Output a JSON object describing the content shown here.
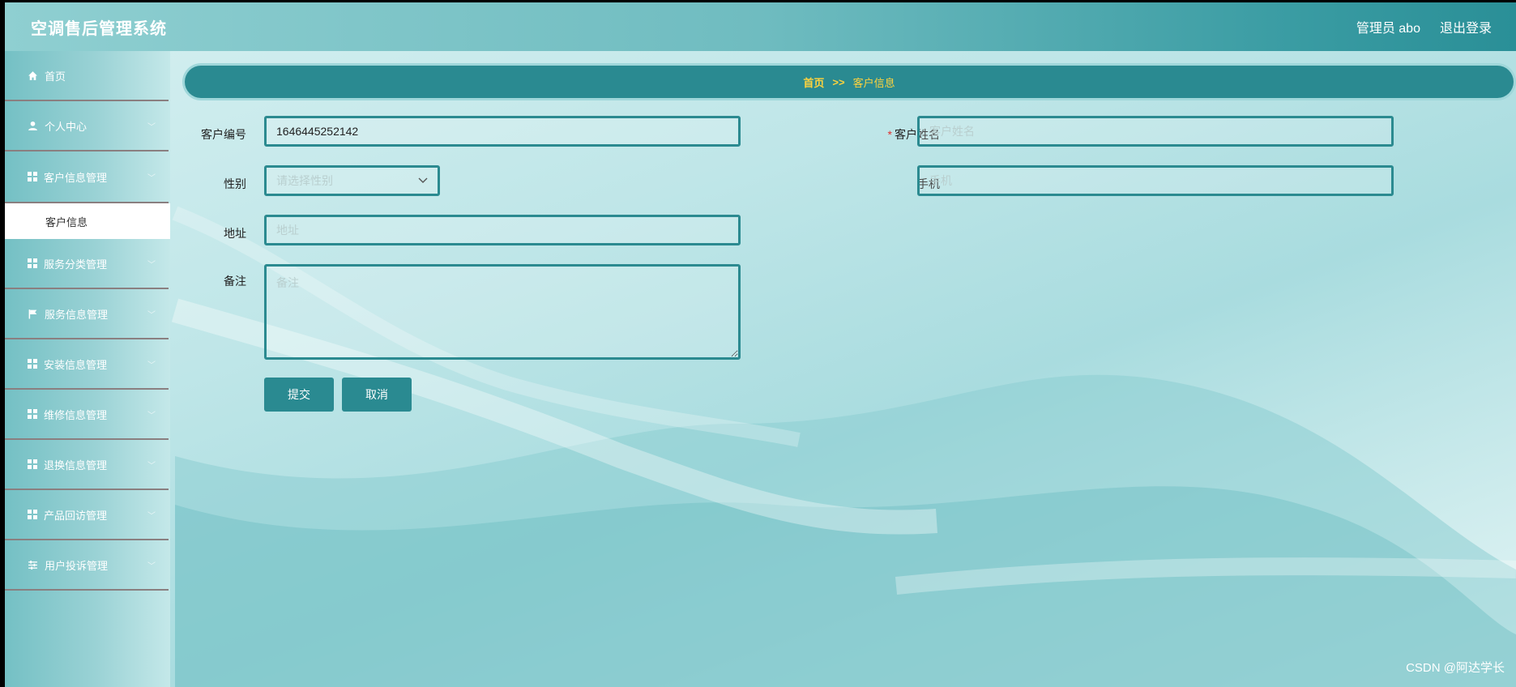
{
  "header": {
    "title": "空调售后管理系统",
    "user_label": "管理员 abo",
    "logout_label": "退出登录"
  },
  "sidebar": {
    "items": [
      {
        "label": "首页",
        "icon": "home-icon"
      },
      {
        "label": "个人中心",
        "icon": "user-icon"
      },
      {
        "label": "客户信息管理",
        "icon": "grid-icon",
        "sub": [
          "客户信息"
        ]
      },
      {
        "label": "服务分类管理",
        "icon": "grid-icon"
      },
      {
        "label": "服务信息管理",
        "icon": "flag-icon"
      },
      {
        "label": "安装信息管理",
        "icon": "grid-icon"
      },
      {
        "label": "维修信息管理",
        "icon": "grid-icon"
      },
      {
        "label": "退换信息管理",
        "icon": "grid-icon"
      },
      {
        "label": "产品回访管理",
        "icon": "grid-icon"
      },
      {
        "label": "用户投诉管理",
        "icon": "sliders-icon"
      }
    ]
  },
  "breadcrumb": {
    "home": "首页",
    "separator": ">>",
    "current": "客户信息"
  },
  "form": {
    "customer_no": {
      "label": "客户编号",
      "value": "1646445252142"
    },
    "customer_name": {
      "label": "客户姓名",
      "placeholder": "客户姓名",
      "required_mark": "*"
    },
    "gender": {
      "label": "性别",
      "placeholder": "请选择性别"
    },
    "phone": {
      "label": "手机",
      "placeholder": "手机"
    },
    "address": {
      "label": "地址",
      "placeholder": "地址"
    },
    "remark": {
      "label": "备注",
      "placeholder": "备注"
    },
    "submit_label": "提交",
    "cancel_label": "取消"
  },
  "watermark": "CSDN @阿达学长"
}
